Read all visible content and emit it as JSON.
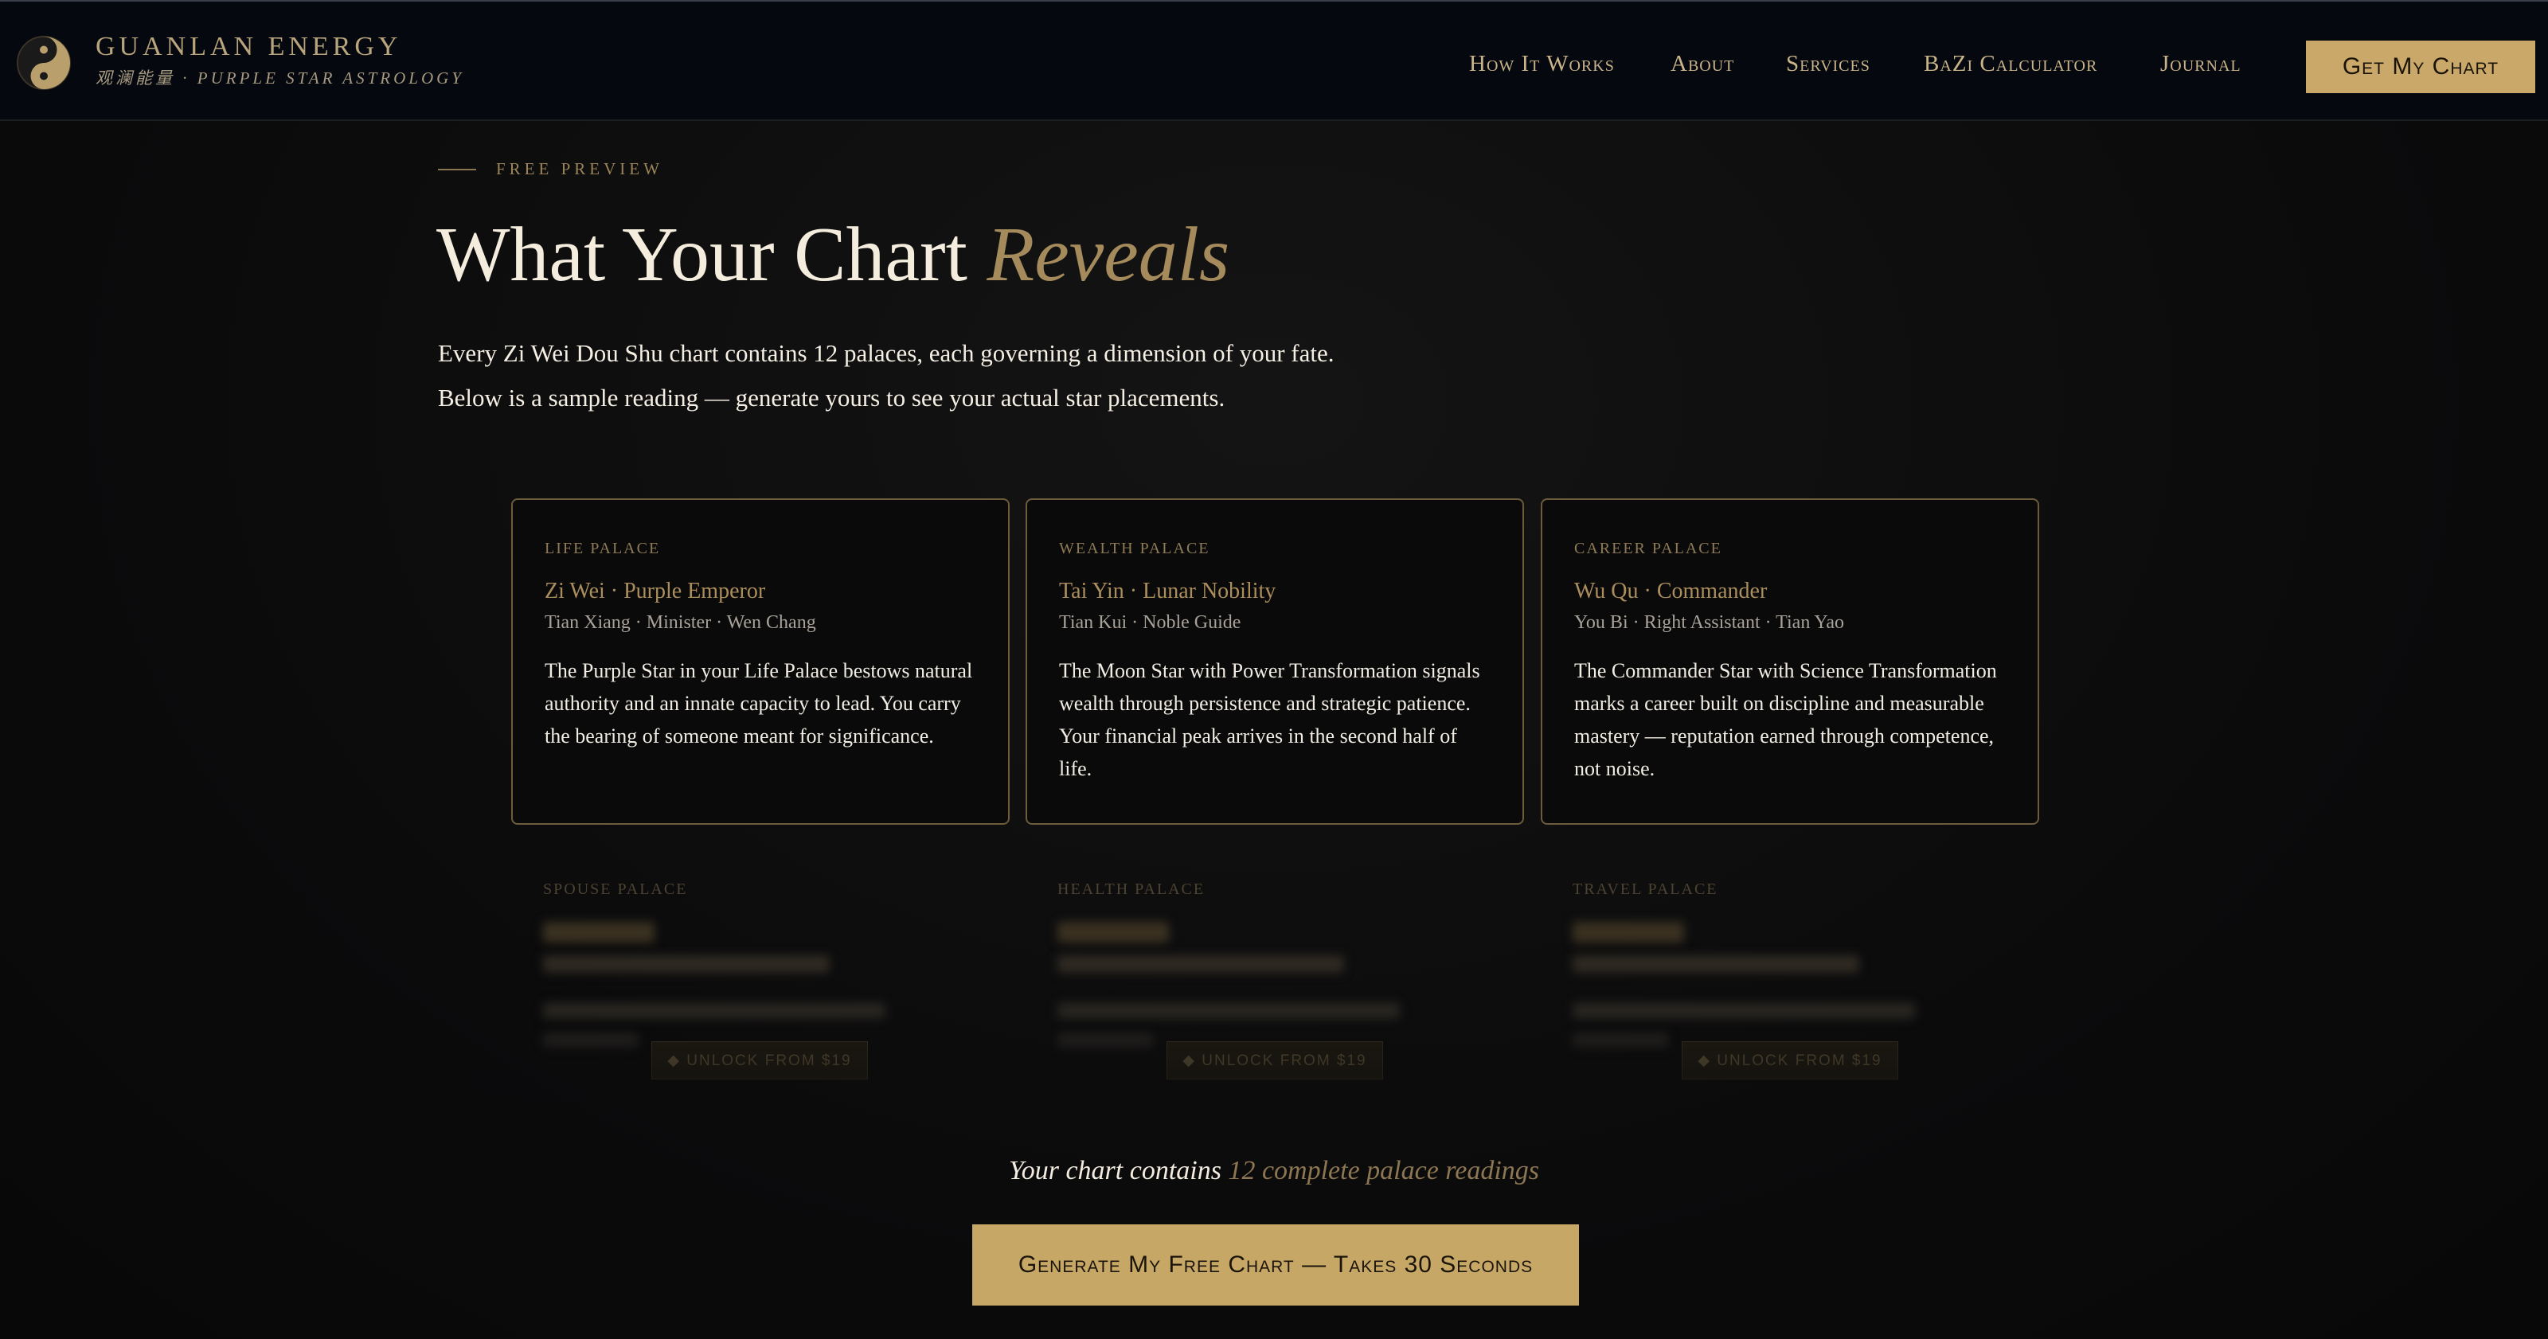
{
  "header": {
    "brand_name": "GUANLAN ENERGY",
    "brand_sub": "观澜能量 · PURPLE STAR ASTROLOGY",
    "nav": {
      "how_it_works": "How It Works",
      "about": "About",
      "services": "Services",
      "bazi": "BaZi Calculator",
      "journal": "Journal"
    },
    "cta_label": "Get My Chart"
  },
  "hero": {
    "eyebrow": "FREE PREVIEW",
    "headline_main": "What Your Chart ",
    "headline_accent": "Reveals",
    "intro_line1": "Every Zi Wei Dou Shu chart contains 12 palaces, each governing a dimension of your fate.",
    "intro_line2": "Below is a sample reading — generate yours to see your actual star placements."
  },
  "cards": [
    {
      "palace": "LIFE PALACE",
      "star": "Zi Wei · Purple Emperor",
      "minor": "Tian Xiang · Minister  ·  Wen Chang",
      "description": "The Purple Star in your Life Palace bestows natural authority and an innate capacity to lead. You carry the bearing of someone meant for significance."
    },
    {
      "palace": "WEALTH PALACE",
      "star": "Tai Yin · Lunar Nobility",
      "minor": "Tian Kui · Noble Guide",
      "description": "The Moon Star with Power Transformation signals wealth through persistence and strategic patience. Your financial peak arrives in the second half of life."
    },
    {
      "palace": "CAREER PALACE",
      "star": "Wu Qu · Commander",
      "minor": "You Bi · Right Assistant  ·  Tian Yao",
      "description": "The Commander Star with Science Transformation marks a career built on discipline and measurable mastery — reputation earned through competence, not noise."
    }
  ],
  "locked_cards": [
    {
      "palace": "SPOUSE PALACE",
      "unlock_label": "◆ UNLOCK FROM $19"
    },
    {
      "palace": "HEALTH PALACE",
      "unlock_label": "◆ UNLOCK FROM $19"
    },
    {
      "palace": "TRAVEL PALACE",
      "unlock_label": "◆ UNLOCK FROM $19"
    }
  ],
  "footer": {
    "count_prefix": "Your chart contains ",
    "count_accent": "12 complete palace readings",
    "cta_label": "Generate My Free Chart — Takes 30 Seconds"
  },
  "colors": {
    "gold": "#caa86a",
    "accent_text": "#a58a5c",
    "background": "#0b0b0c",
    "header_bg": "#05080f"
  }
}
